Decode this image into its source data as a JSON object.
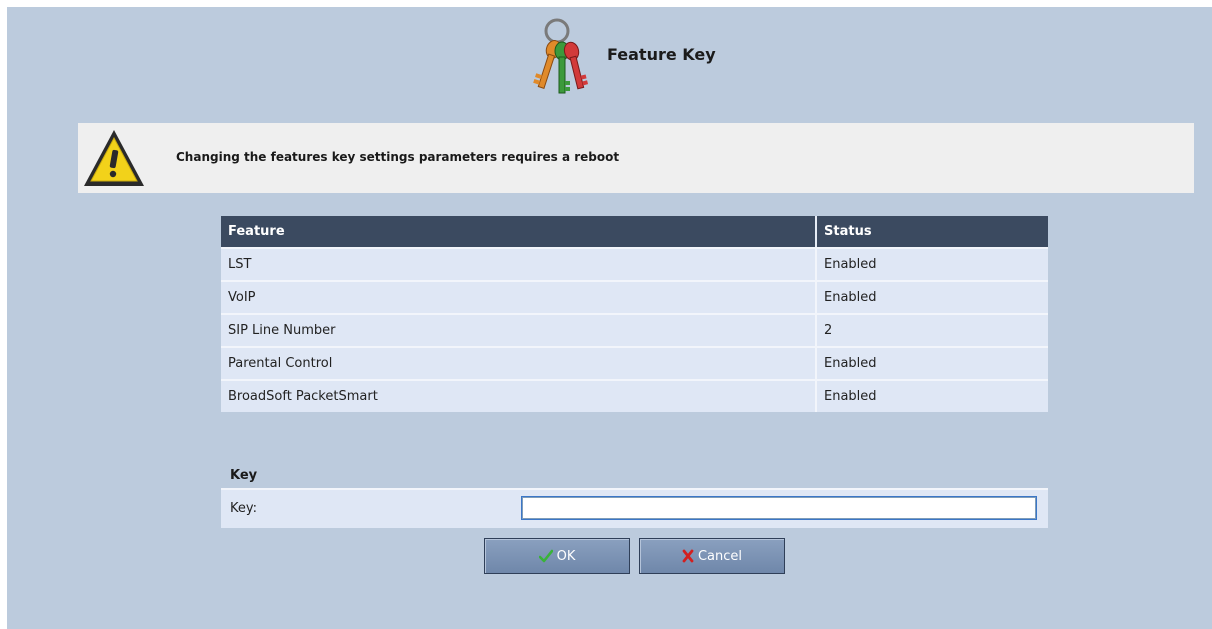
{
  "header": {
    "title": "Feature Key",
    "icon": "keys-icon"
  },
  "warning": {
    "icon": "warning-icon",
    "message": "Changing the features key settings parameters requires a reboot"
  },
  "feature_table": {
    "columns": [
      "Feature",
      "Status"
    ],
    "rows": [
      {
        "feature": "LST",
        "status": "Enabled"
      },
      {
        "feature": "VoIP",
        "status": "Enabled"
      },
      {
        "feature": "SIP Line Number",
        "status": "2"
      },
      {
        "feature": "Parental Control",
        "status": "Enabled"
      },
      {
        "feature": "BroadSoft PacketSmart",
        "status": "Enabled"
      }
    ]
  },
  "key_section": {
    "heading": "Key",
    "label": "Key:",
    "value": ""
  },
  "buttons": {
    "ok_label": "OK",
    "ok_icon": "checkmark-icon",
    "cancel_label": "Cancel",
    "cancel_icon": "x-icon"
  },
  "colors": {
    "background": "#bccbdd",
    "table_header": "#3b4a60",
    "row": "#dfe7f5",
    "button": "#7a90b1"
  }
}
